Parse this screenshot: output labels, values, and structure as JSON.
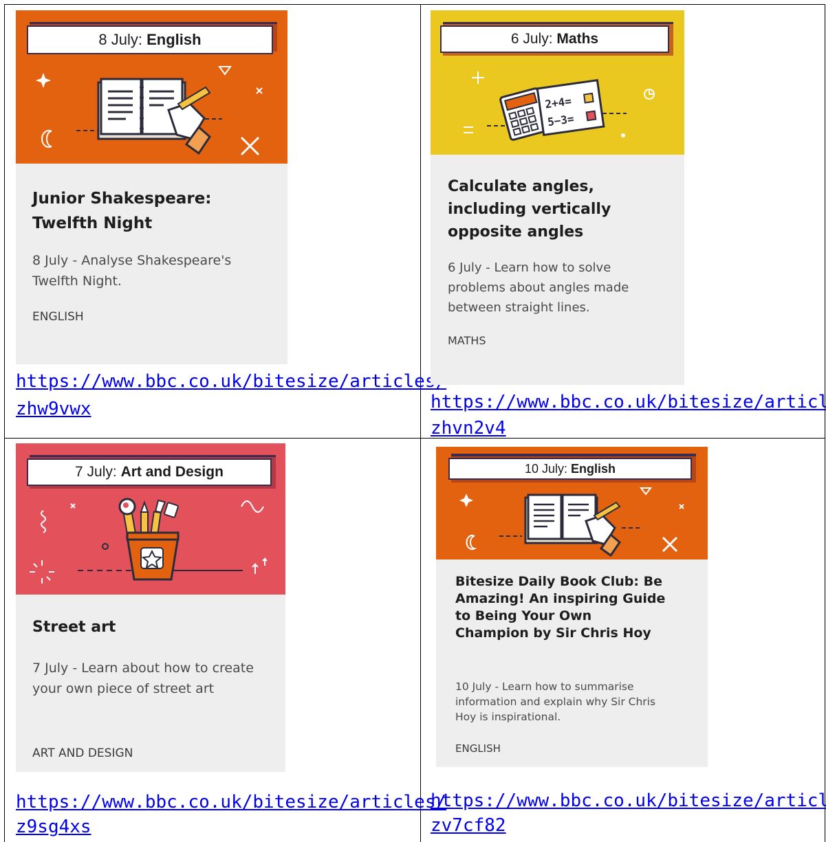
{
  "colors": {
    "english": "#e2620f",
    "maths": "#ebc81f",
    "art": "#e3525a",
    "body": "#eeeeee",
    "link": "#0000ee",
    "frame": "#3a2c4f"
  },
  "cards": [
    {
      "label_date": "8 July: ",
      "label_subject": "English",
      "title": "Junior Shakespeare: Twelfth Night",
      "description": "8 July - Analyse Shakespeare's Twelfth Night.",
      "subject_tag": "ENGLISH",
      "link_line1": "https://www.bbc.co.uk/bitesize/articles/",
      "link_line2": "zhw9vwx",
      "icon": "open-book-icon"
    },
    {
      "label_date": "6 July: ",
      "label_subject": "Maths",
      "title": "Calculate angles, including vertically opposite angles",
      "description": "6 July - Learn how to solve problems about angles made between straight lines.",
      "subject_tag": "MATHS",
      "equation1": "2+4=",
      "equation2": "5−3=",
      "link_line1": "https://www.bbc.co.uk/bitesize/articles/",
      "link_line2": "zhvn2v4",
      "icon": "calculator-icon"
    },
    {
      "label_date": "7 July: ",
      "label_subject": "Art and Design",
      "title": "Street art",
      "description": "7 July - Learn about how to create your own piece of street art",
      "subject_tag": "ART AND DESIGN",
      "link_line1": "https://www.bbc.co.uk/bitesize/articles/",
      "link_line2": "z9sg4xs",
      "icon": "paintbrush-pot-icon"
    },
    {
      "label_date": "10 July: ",
      "label_subject": "English",
      "title": "Bitesize Daily Book Club: Be Amazing! An inspiring Guide to Being Your Own Champion by Sir Chris Hoy",
      "description": "10 July - Learn how to summarise information and explain why Sir Chris Hoy is inspirational.",
      "subject_tag": "ENGLISH",
      "link_line1": "https://www.bbc.co.uk/bitesize/articles/",
      "link_line2": "zv7cf82",
      "icon": "open-book-icon"
    }
  ]
}
